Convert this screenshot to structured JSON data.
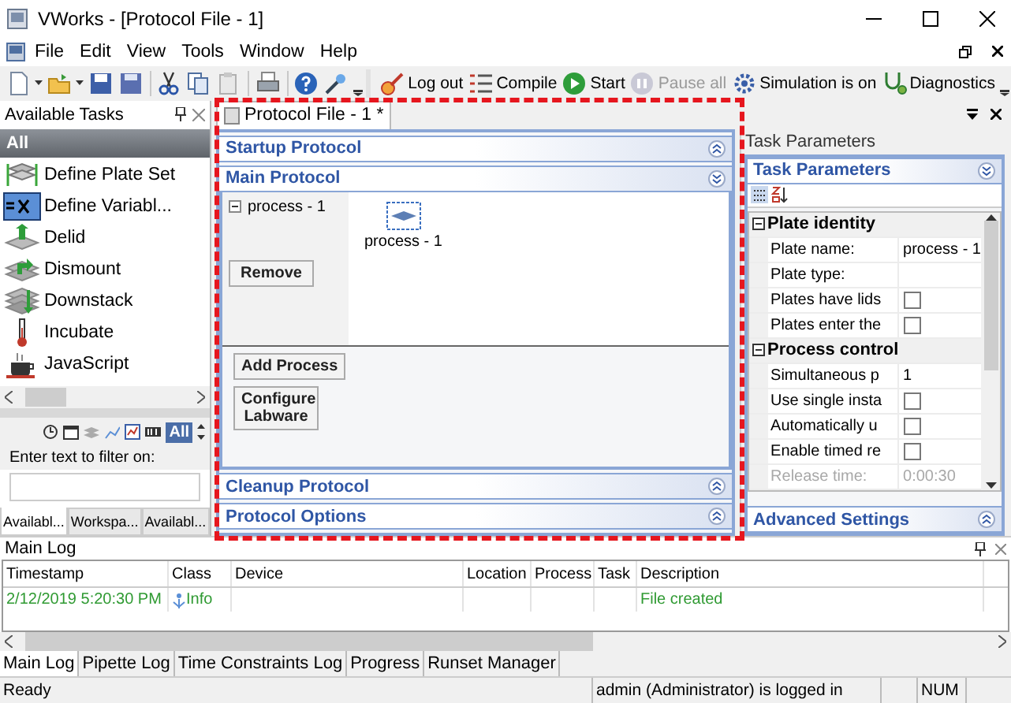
{
  "window": {
    "title": "VWorks - [Protocol File - 1]"
  },
  "menu": [
    {
      "label": "File"
    },
    {
      "label": "Edit"
    },
    {
      "label": "View"
    },
    {
      "label": "Tools"
    },
    {
      "label": "Window"
    },
    {
      "label": "Help"
    }
  ],
  "toolbar": {
    "buttons": [
      {
        "label": "Log out",
        "disabled": false
      },
      {
        "label": "Compile",
        "disabled": false
      },
      {
        "label": "Start",
        "disabled": false
      },
      {
        "label": "Pause all",
        "disabled": true
      },
      {
        "label": "Simulation is on",
        "disabled": false
      },
      {
        "label": "Diagnostics",
        "disabled": false
      }
    ]
  },
  "available_tasks": {
    "title": "Available Tasks",
    "category": "All",
    "tasks": [
      {
        "label": "Define Plate Set"
      },
      {
        "label": "Define Variabl..."
      },
      {
        "label": "Delid"
      },
      {
        "label": "Dismount"
      },
      {
        "label": "Downstack"
      },
      {
        "label": "Incubate"
      },
      {
        "label": "JavaScript"
      }
    ],
    "filter_button": "All",
    "filter_label": "Enter text to filter on:",
    "tabs": [
      {
        "label": "Availabl...",
        "selected": true
      },
      {
        "label": "Workspa...",
        "selected": false
      },
      {
        "label": "Availabl...",
        "selected": false
      }
    ]
  },
  "document_tab": {
    "label": "Protocol File - 1 *",
    "selected": true
  },
  "protocol": {
    "sections": [
      {
        "title": "Startup Protocol",
        "expanded": false
      },
      {
        "title": "Main Protocol",
        "expanded": true
      },
      {
        "title": "Cleanup Protocol",
        "expanded": false
      },
      {
        "title": "Protocol Options",
        "expanded": false
      }
    ],
    "process": {
      "label": "process - 1",
      "expanded": true
    },
    "node_label": "process - 1",
    "buttons": [
      "Remove",
      "Add Process",
      "Configure Labware"
    ]
  },
  "task_parameters": {
    "title": "Task Parameters",
    "section": "Task Parameters",
    "groups": [
      {
        "title": "Plate identity",
        "expanded": true,
        "rows": [
          {
            "kind": "text",
            "name": "Plate name:",
            "value": "process - 1",
            "disabled": false
          },
          {
            "kind": "text",
            "name": "Plate type:",
            "disabled": false
          },
          {
            "kind": "checkbox",
            "name": "Plates have lids",
            "checked": false,
            "disabled": false
          },
          {
            "kind": "checkbox",
            "name": "Plates enter the",
            "checked": false,
            "disabled": false
          }
        ]
      },
      {
        "title": "Process control",
        "expanded": true,
        "rows": [
          {
            "kind": "text",
            "name": "Simultaneous p",
            "value": "1",
            "disabled": false
          },
          {
            "kind": "checkbox",
            "name": "Use single insta",
            "checked": false,
            "disabled": false
          },
          {
            "kind": "checkbox",
            "name": "Automatically u",
            "checked": false,
            "disabled": false
          },
          {
            "kind": "checkbox",
            "name": "Enable timed re",
            "checked": false,
            "disabled": false
          },
          {
            "kind": "text",
            "name": "Release time:",
            "value": "0:00:30",
            "disabled": true
          }
        ]
      }
    ],
    "advanced": "Advanced Settings"
  },
  "log": {
    "title": "Main Log",
    "columns": [
      "Timestamp",
      "Class",
      "Device",
      "Location",
      "Process",
      "Task",
      "Description"
    ],
    "rows": [
      {
        "cells": [
          "2/12/2019 5:20:30 PM",
          "Info",
          "",
          "",
          "",
          "",
          "File created"
        ]
      }
    ],
    "tabs": [
      {
        "label": "Main Log",
        "selected": true
      },
      {
        "label": "Pipette Log",
        "selected": false
      },
      {
        "label": "Time Constraints Log",
        "selected": false
      },
      {
        "label": "Progress",
        "selected": false
      },
      {
        "label": "Runset Manager",
        "selected": false
      }
    ]
  },
  "status_bar": [
    "Ready",
    "admin (Administrator) is logged in",
    "NUM"
  ]
}
